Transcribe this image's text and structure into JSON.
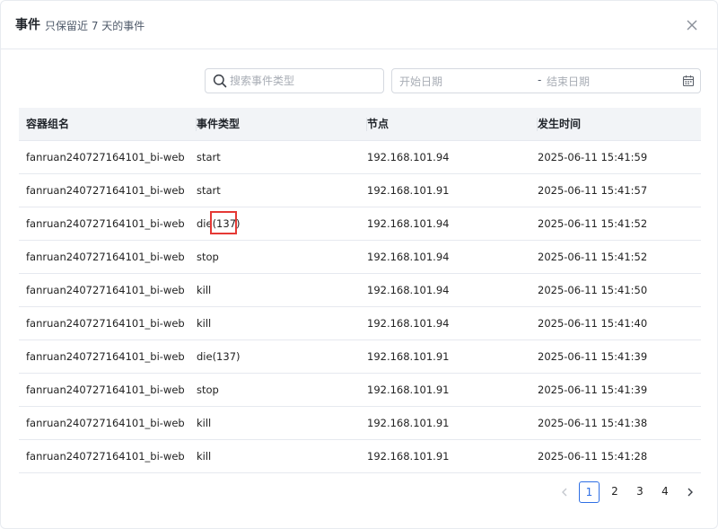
{
  "header": {
    "title": "事件",
    "subtitle": "只保留近 7 天的事件"
  },
  "filters": {
    "search_placeholder": "搜索事件类型",
    "date_start_placeholder": "开始日期",
    "date_separator": "-",
    "date_end_placeholder": "结束日期"
  },
  "table": {
    "columns": [
      "容器组名",
      "事件类型",
      "节点",
      "发生时间"
    ],
    "rows": [
      [
        "fanruan240727164101_bi-web",
        "start",
        "192.168.101.94",
        "2025-06-11 15:41:59"
      ],
      [
        "fanruan240727164101_bi-web",
        "start",
        "192.168.101.91",
        "2025-06-11 15:41:57"
      ],
      [
        "fanruan240727164101_bi-web",
        "die(137)",
        "192.168.101.94",
        "2025-06-11 15:41:52"
      ],
      [
        "fanruan240727164101_bi-web",
        "stop",
        "192.168.101.94",
        "2025-06-11 15:41:52"
      ],
      [
        "fanruan240727164101_bi-web",
        "kill",
        "192.168.101.94",
        "2025-06-11 15:41:50"
      ],
      [
        "fanruan240727164101_bi-web",
        "kill",
        "192.168.101.94",
        "2025-06-11 15:41:40"
      ],
      [
        "fanruan240727164101_bi-web",
        "die(137)",
        "192.168.101.91",
        "2025-06-11 15:41:39"
      ],
      [
        "fanruan240727164101_bi-web",
        "stop",
        "192.168.101.91",
        "2025-06-11 15:41:39"
      ],
      [
        "fanruan240727164101_bi-web",
        "kill",
        "192.168.101.91",
        "2025-06-11 15:41:38"
      ],
      [
        "fanruan240727164101_bi-web",
        "kill",
        "192.168.101.91",
        "2025-06-11 15:41:28"
      ]
    ]
  },
  "pagination": {
    "prev": "‹",
    "pages": [
      "1",
      "2",
      "3",
      "4"
    ],
    "next": "›",
    "current": "1"
  },
  "icons": {
    "close": "close-icon",
    "search": "search-icon",
    "calendar": "calendar-icon",
    "prev": "chevron-left-icon",
    "next": "chevron-right-icon"
  },
  "colors": {
    "accent": "#2f6fe4",
    "highlight": "#e53935",
    "header_bg": "#f2f4f7"
  }
}
